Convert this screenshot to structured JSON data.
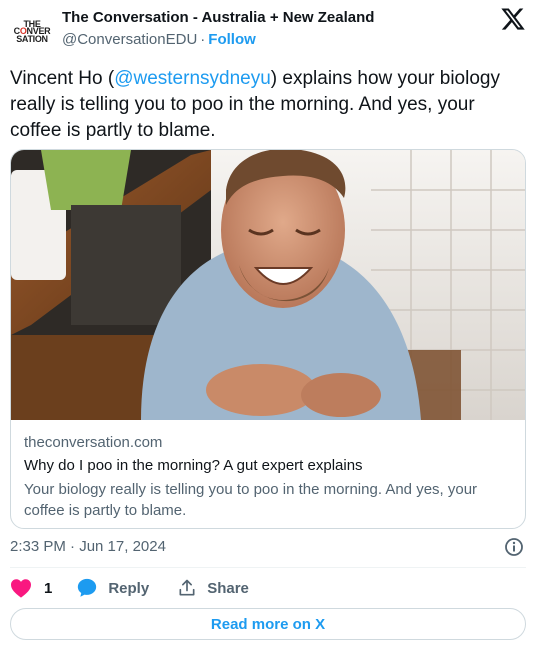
{
  "author": {
    "avatar_text": [
      "THE",
      "CONVER",
      "SATION"
    ],
    "display_name": "The Conversation - Australia + New Zealand",
    "handle": "@ConversationEDU",
    "separator": "·",
    "follow_label": "Follow"
  },
  "tweet": {
    "text_before": "Vincent Ho (",
    "mention": "@westernsydneyu",
    "text_after": ") explains how your biology really is telling you to poo in the morning. And yes, your coffee is partly to blame."
  },
  "card": {
    "domain": "theconversation.com",
    "title": "Why do I poo in the morning? A gut expert explains",
    "description": "Your biology really is telling you to poo in the morning. And yes, your coffee is partly to blame."
  },
  "meta": {
    "timestamp": "2:33 PM · Jun 17, 2024"
  },
  "actions": {
    "like_count": "1",
    "reply_label": "Reply",
    "share_label": "Share",
    "read_more_label": "Read more on X"
  },
  "colors": {
    "accent": "#1d9bf0",
    "like": "#f91880",
    "text": "#0f1419",
    "secondary": "#536471",
    "border": "#cfd9de"
  },
  "icons": {
    "brand": "x-logo-icon",
    "info": "info-icon",
    "like": "heart-icon",
    "reply": "speech-bubble-icon",
    "share": "share-upload-icon"
  }
}
